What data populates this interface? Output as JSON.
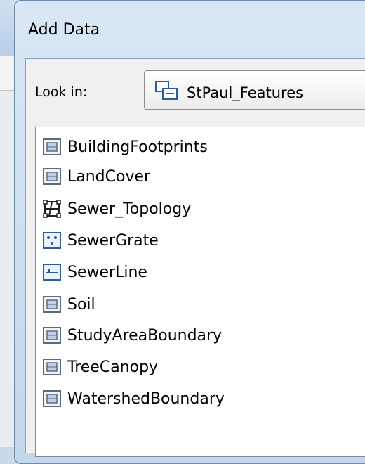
{
  "dialog": {
    "title": "Add Data",
    "look_in_label": "Look in:",
    "look_in_value": "StPaul_Features"
  },
  "items": [
    {
      "label": "BuildingFootprints",
      "icon": "polygon-feature-class-icon"
    },
    {
      "label": "LandCover",
      "icon": "polygon-feature-class-icon"
    },
    {
      "label": "Sewer_Topology",
      "icon": "topology-icon"
    },
    {
      "label": "SewerGrate",
      "icon": "point-feature-class-icon"
    },
    {
      "label": "SewerLine",
      "icon": "line-feature-class-icon"
    },
    {
      "label": "Soil",
      "icon": "polygon-feature-class-icon"
    },
    {
      "label": "StudyAreaBoundary",
      "icon": "polygon-feature-class-icon"
    },
    {
      "label": "TreeCanopy",
      "icon": "polygon-feature-class-icon"
    },
    {
      "label": "WatershedBoundary",
      "icon": "polygon-feature-class-icon"
    }
  ]
}
